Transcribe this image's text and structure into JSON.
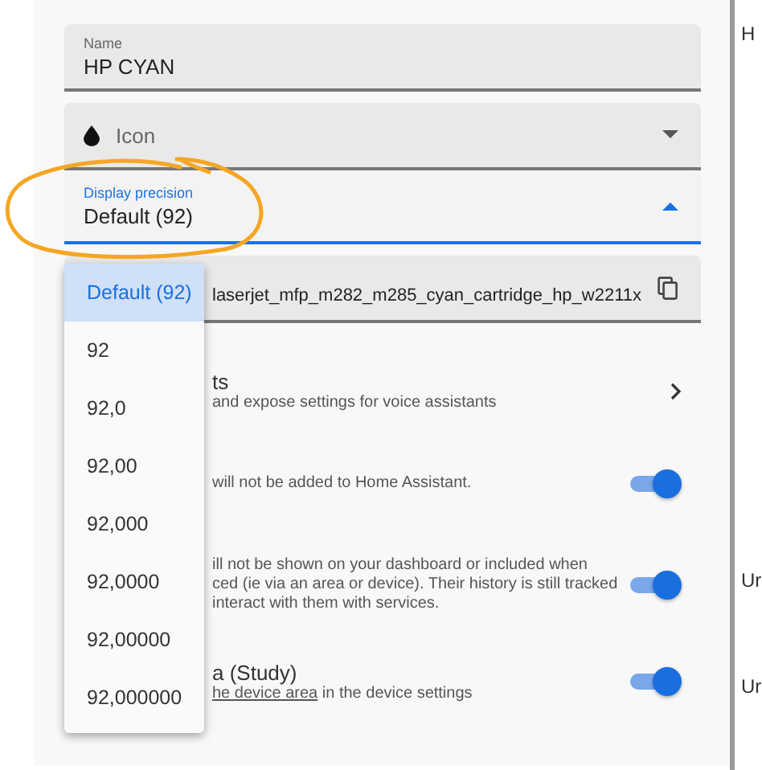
{
  "fields": [
    {
      "kind": "text",
      "label": "Name",
      "value": "HP CYAN",
      "focused": false
    },
    {
      "kind": "icon-select",
      "placeholder": "Icon",
      "focused": false
    },
    {
      "kind": "select",
      "label": "Display precision",
      "value": "Default (92)",
      "focused": true
    },
    {
      "kind": "copy",
      "value": "laserjet_mfp_m282_m285_cyan_cartridge_hp_w2211x",
      "focused": false
    }
  ],
  "menu": [
    {
      "label": "Default (92)",
      "selected": true
    },
    {
      "label": "92",
      "selected": false
    },
    {
      "label": "92,0",
      "selected": false
    },
    {
      "label": "92,00",
      "selected": false
    },
    {
      "label": "92,000",
      "selected": false
    },
    {
      "label": "92,0000",
      "selected": false
    },
    {
      "label": "92,00000",
      "selected": false
    },
    {
      "label": "92,000000",
      "selected": false
    }
  ],
  "rows": [
    {
      "kind": "link",
      "title": "ts",
      "subtitle": [
        "and expose settings for voice assistants"
      ]
    },
    {
      "kind": "toggle",
      "on": true,
      "subtitle": [
        "will not be added to Home Assistant."
      ]
    },
    {
      "kind": "toggle",
      "on": true,
      "subtitle": [
        "ill not be shown on your dashboard or included when",
        "ced (ie via an area or device). Their history is still tracked",
        "interact with them with services."
      ]
    },
    {
      "kind": "toggle",
      "on": true,
      "title": "a (Study)",
      "link": "he device area",
      "subtitle": [
        " in the device settings"
      ]
    }
  ],
  "side_texts": [
    "H",
    "Ur",
    "Ur"
  ]
}
